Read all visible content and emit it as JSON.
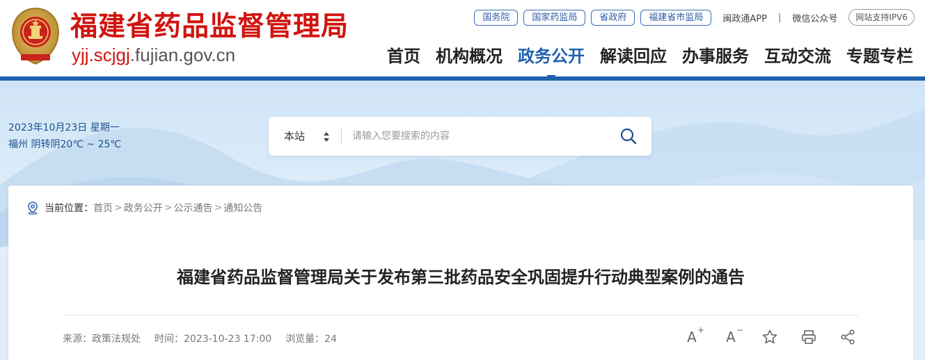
{
  "header": {
    "site_title": "福建省药品监督管理局",
    "domain_red": "yjj.scjgj",
    "domain_gray": ".fujian.gov.cn",
    "top_links": [
      "国务院",
      "国家药监局",
      "省政府",
      "福建省市监局"
    ],
    "app_link": "闽政通APP",
    "separator": "|",
    "wechat_link": "微信公众号",
    "ipv6_badge": "网站支持IPV6",
    "nav": [
      "首页",
      "机构概况",
      "政务公开",
      "解读回应",
      "办事服务",
      "互动交流",
      "专题专栏"
    ],
    "active_nav": "政务公开",
    "colors": {
      "brand_red": "#d0140f",
      "brand_blue": "#1f61ad"
    }
  },
  "banner": {
    "date_line": "2023年10月23日 星期一",
    "weather_line": "福州 阴转阴20℃ ~ 25℃",
    "search": {
      "scope": "本站",
      "placeholder": "请输入您要搜索的内容",
      "icon": "search-icon"
    }
  },
  "breadcrumb": {
    "label": "当前位置：",
    "items": [
      "首页",
      "政务公开",
      "公示通告",
      "通知公告"
    ],
    "separator": ">"
  },
  "article": {
    "title": "福建省药品监督管理局关于发布第三批药品安全巩固提升行动典型案例的通告",
    "source": "来源：政策法规处",
    "time": "时间：2023-10-23 17:00",
    "views": "浏览量：24"
  },
  "tools": {
    "font_up_letter": "A",
    "font_up_sign": "+",
    "font_down_letter": "A",
    "font_down_sign": "−",
    "icons": [
      "font-increase-icon",
      "font-decrease-icon",
      "star-icon",
      "print-icon",
      "share-icon"
    ]
  }
}
